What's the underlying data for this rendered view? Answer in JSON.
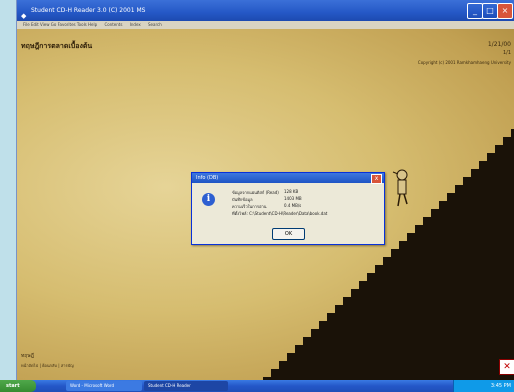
{
  "window": {
    "title": "Student CD-H Reader 3.0 (C) 2001 MS",
    "menu": [
      "File  Edit  View  Go  Favorites  Tools  Help",
      "Contents",
      "Index",
      "Search"
    ]
  },
  "page": {
    "title": "ทฤษฎีการตลาดเบื้องต้น",
    "top_right_1": "1/21/00",
    "top_right_2": "1/1",
    "top_right_3": "Copyright (c) 2001 Ramkhamhaeng University",
    "bottom_left_1": "ทฤษฎี",
    "bottom_left_2": "หน้าถัดไป  |  ย้อนกลับ  |  สารบัญ"
  },
  "dialog": {
    "title": "Info (DB)",
    "close": "x",
    "rows": [
      {
        "label": "ข้อมูลจากแผ่นดิสก์ (Read)",
        "value": "128 KB"
      },
      {
        "label": "บันทึกข้อมูล",
        "value": "1403 MB"
      },
      {
        "label": "ความเร็วในการอ่าน",
        "value": "0.4 MB/s"
      },
      {
        "label": "ที่ตั้งไฟล์: C:\\Student\\CD-H\\Reader\\Data\\book.dat",
        "value": ""
      }
    ],
    "ok": "OK"
  },
  "taskbar": {
    "start": "start",
    "items": [
      "Word - Microsoft Word",
      "Student CD-H Reader"
    ],
    "clock": "3:45 PM"
  }
}
